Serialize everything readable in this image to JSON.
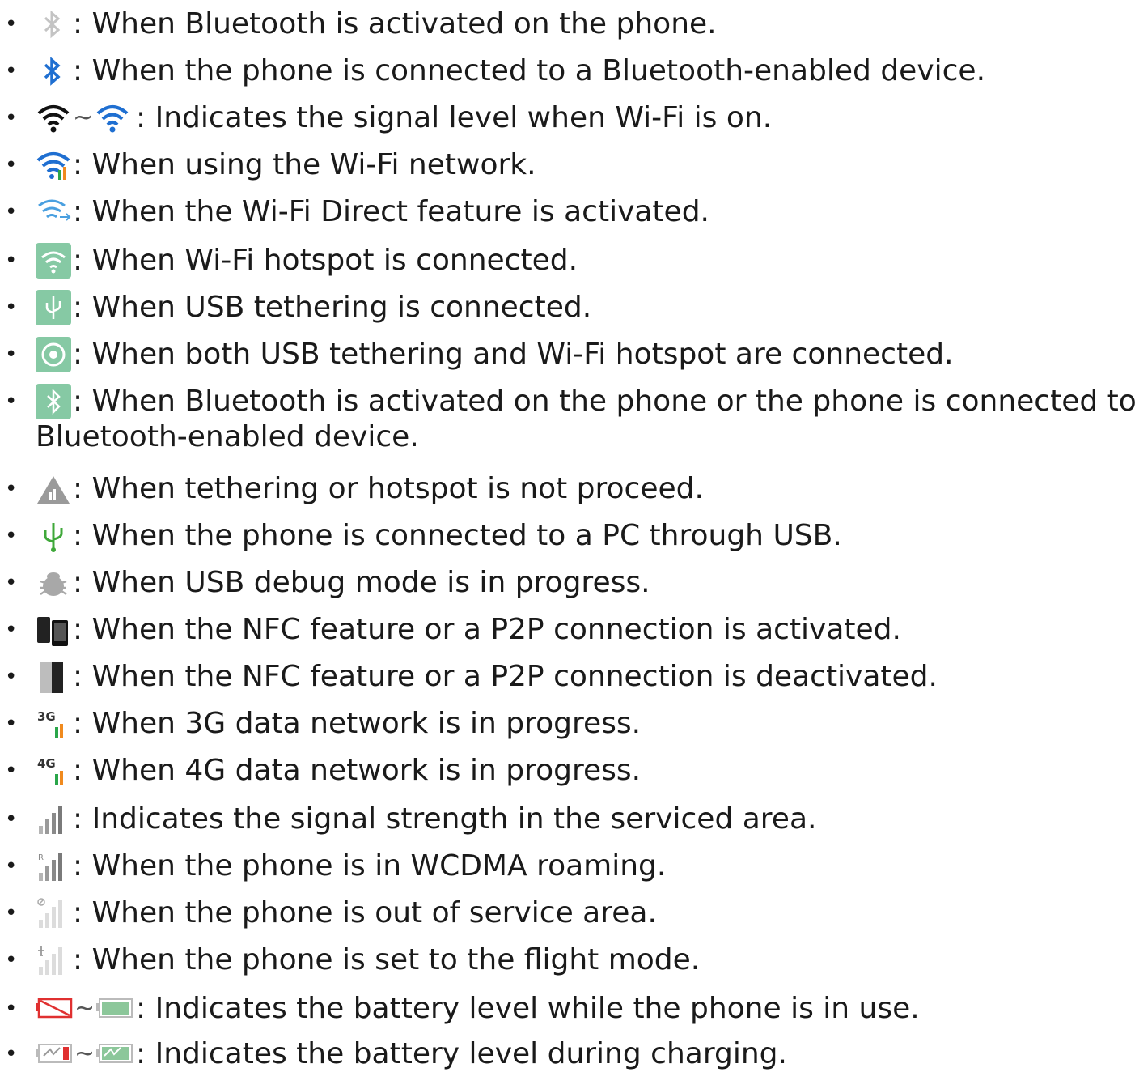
{
  "items": [
    {
      "icons": [
        "bluetooth-on-gray-icon"
      ],
      "text": ": When Bluetooth is activated on the phone."
    },
    {
      "icons": [
        "bluetooth-connected-blue-icon"
      ],
      "text": ": When the phone is connected to a Bluetooth-enabled device."
    },
    {
      "icons": [
        "wifi-signal-black-icon",
        "wifi-signal-blue-icon"
      ],
      "sep": "~",
      "text": ": Indicates the signal level when Wi-Fi is on."
    },
    {
      "icons": [
        "wifi-in-use-icon"
      ],
      "text": ": When using the Wi-Fi network."
    },
    {
      "icons": [
        "wifi-direct-icon"
      ],
      "text": ": When the Wi-Fi Direct feature is activated."
    },
    {
      "icons": [
        "wifi-hotspot-icon"
      ],
      "text": ": When Wi-Fi hotspot is connected."
    },
    {
      "icons": [
        "usb-tethering-icon"
      ],
      "text": ": When USB tethering is connected."
    },
    {
      "icons": [
        "usb-wifi-tethering-icon"
      ],
      "text": ": When both USB tethering and Wi-Fi hotspot are connected."
    },
    {
      "icons": [
        "bluetooth-tethering-icon"
      ],
      "text": ": When Bluetooth is activated on the phone or the phone is connected to a",
      "text2": "Bluetooth-enabled device."
    },
    {
      "icons": [
        "tethering-warning-icon"
      ],
      "text": ": When tethering or hotspot is not proceed."
    },
    {
      "icons": [
        "usb-connected-icon"
      ],
      "text": ": When the phone is connected to a PC through USB."
    },
    {
      "icons": [
        "usb-debug-icon"
      ],
      "text": ": When USB debug mode is in progress."
    },
    {
      "icons": [
        "nfc-active-icon"
      ],
      "text": ": When the NFC feature or a P2P connection is activated."
    },
    {
      "icons": [
        "nfc-inactive-icon"
      ],
      "text": ": When the NFC feature or a P2P connection is deactivated."
    },
    {
      "icons": [
        "3g-data-icon"
      ],
      "text": ": When 3G data network is in progress.",
      "badge": "3G"
    },
    {
      "icons": [
        "4g-data-icon"
      ],
      "text": ": When 4G data network is in progress.",
      "badge": "4G"
    },
    {
      "icons": [
        "signal-strength-icon"
      ],
      "text": ": Indicates the signal strength in the serviced area."
    },
    {
      "icons": [
        "roaming-signal-icon"
      ],
      "text": ": When the phone is in WCDMA roaming.",
      "badge": "R"
    },
    {
      "icons": [
        "no-service-icon"
      ],
      "text": ": When the phone is out of service area."
    },
    {
      "icons": [
        "flight-mode-icon"
      ],
      "text": ": When the phone is set to the flight mode."
    },
    {
      "icons": [
        "battery-empty-icon",
        "battery-full-icon"
      ],
      "sep": "~",
      "text": ": Indicates the battery level while the phone is in use."
    },
    {
      "icons": [
        "battery-charging-low-icon",
        "battery-charging-full-icon"
      ],
      "sep": "~",
      "text": ": Indicates the battery level during charging."
    }
  ],
  "bullet": "•",
  "colors": {
    "text": "#1a1a1a",
    "blue": "#1f6fd1",
    "green": "#7dc59a",
    "gray": "#b0b0b0"
  }
}
